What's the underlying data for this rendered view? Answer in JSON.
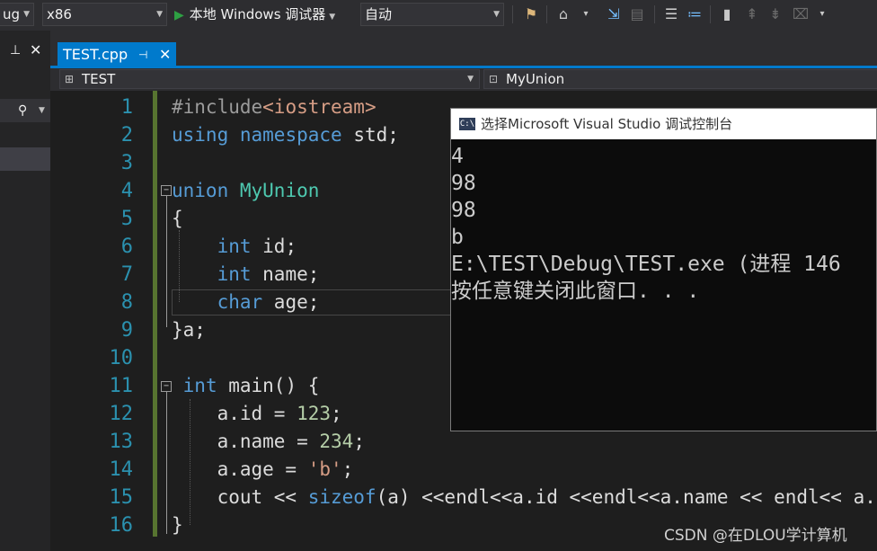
{
  "toolbar": {
    "config_value": "ug",
    "platform_value": "x86",
    "run_label": "本地 Windows 调试器",
    "solution_config_value": "自动"
  },
  "left_panel": {
    "pin_glyph": "⊥",
    "close_glyph": "✕"
  },
  "tab": {
    "file_name": "TEST.cpp",
    "pin_glyph": "⊣",
    "close_glyph": "✕"
  },
  "navigation": {
    "scope_value": "TEST",
    "member_value": "MyUnion"
  },
  "editor": {
    "line_numbers": [
      "1",
      "2",
      "3",
      "4",
      "5",
      "6",
      "7",
      "8",
      "9",
      "10",
      "11",
      "12",
      "13",
      "14",
      "15",
      "16"
    ],
    "lines": [
      [
        {
          "t": "#include",
          "c": "inc"
        },
        {
          "t": "<iostream>",
          "c": "str"
        }
      ],
      [
        {
          "t": "using",
          "c": "kw"
        },
        {
          "t": " "
        },
        {
          "t": "namespace",
          "c": "kw"
        },
        {
          "t": " std;"
        }
      ],
      [],
      [
        {
          "t": "union",
          "c": "kw"
        },
        {
          "t": " "
        },
        {
          "t": "MyUnion",
          "c": "ty"
        }
      ],
      [
        {
          "t": "{"
        }
      ],
      [
        {
          "t": "    "
        },
        {
          "t": "int",
          "c": "kw"
        },
        {
          "t": " id;"
        }
      ],
      [
        {
          "t": "    "
        },
        {
          "t": "int",
          "c": "kw"
        },
        {
          "t": " name;"
        }
      ],
      [
        {
          "t": "    "
        },
        {
          "t": "char",
          "c": "kw"
        },
        {
          "t": " age;"
        }
      ],
      [
        {
          "t": "}a;"
        }
      ],
      [],
      [
        {
          "t": " "
        },
        {
          "t": "int",
          "c": "kw"
        },
        {
          "t": " main() {"
        }
      ],
      [
        {
          "t": "    a.id = "
        },
        {
          "t": "123",
          "c": "num"
        },
        {
          "t": ";"
        }
      ],
      [
        {
          "t": "    a.name = "
        },
        {
          "t": "234",
          "c": "num"
        },
        {
          "t": ";"
        }
      ],
      [
        {
          "t": "    a.age = "
        },
        {
          "t": "'b'",
          "c": "str"
        },
        {
          "t": ";"
        }
      ],
      [
        {
          "t": "    cout << "
        },
        {
          "t": "sizeof",
          "c": "kw"
        },
        {
          "t": "(a) <<endl<<a.id <<endl<<a.name << endl<< a."
        }
      ],
      [
        {
          "t": "}"
        }
      ]
    ]
  },
  "console": {
    "title": "选择Microsoft Visual Studio 调试控制台",
    "icon_text": "C:\\",
    "output": [
      "4",
      "98",
      "98",
      "b",
      "E:\\TEST\\Debug\\TEST.exe (进程 146",
      "按任意键关闭此窗口. . ."
    ]
  },
  "watermark": "CSDN @在DLOU学计算机"
}
